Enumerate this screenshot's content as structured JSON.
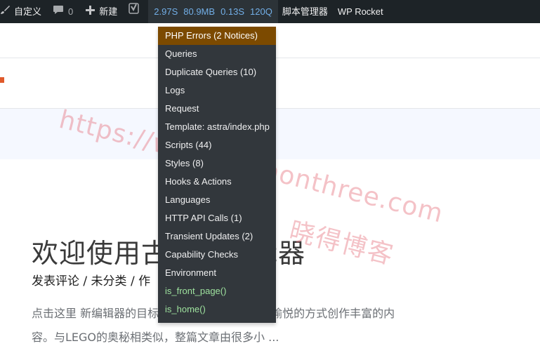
{
  "adminbar": {
    "customize_label": "自定义",
    "comments_count": "0",
    "new_label": "新建",
    "qm_stats": [
      "2.97S",
      "80.9MB",
      "0.13S",
      "120Q"
    ],
    "scripts_manager_label": "脚本管理器",
    "wp_rocket_label": "WP Rocket"
  },
  "post": {
    "title": "欢迎使用古腾堡编辑器",
    "meta": "发表评论 / 未分类 / 作",
    "excerpt_line1": "点击这里 新编辑器的目标是让您以直观、简介和愉悦的方式创作丰富的内",
    "excerpt_line2": "容。与LEGO的奥秘相类似，整篇文章由很多小 ..."
  },
  "qm_menu": {
    "items": [
      {
        "label": "PHP Errors (2 Notices)"
      },
      {
        "label": "Queries"
      },
      {
        "label": "Duplicate Queries (10)"
      },
      {
        "label": "Logs"
      },
      {
        "label": "Request"
      },
      {
        "label": "Template: astra/index.php"
      },
      {
        "label": "Scripts (44)"
      },
      {
        "label": "Styles (8)"
      },
      {
        "label": "Hooks & Actions"
      },
      {
        "label": "Languages"
      },
      {
        "label": "HTTP API Calls (1)"
      },
      {
        "label": "Transient Updates (2)"
      },
      {
        "label": "Capability Checks"
      },
      {
        "label": "Environment"
      },
      {
        "label": "is_front_page()"
      },
      {
        "label": "is_home()"
      }
    ]
  },
  "watermark": {
    "url": "https://www.pythonthree.com",
    "name": "晓得博客"
  },
  "colors": {
    "adminbar_bg": "#1d2327",
    "menu_bg": "#32373c",
    "highlight_bg": "#7c4a00",
    "qm_stat_color": "#72aee6",
    "conditional_color": "#9fe39f"
  },
  "icons": {
    "customize": "brush-icon",
    "comments": "comment-bubble-icon",
    "new": "plus-icon",
    "yoast": "yoast-seo-icon"
  }
}
